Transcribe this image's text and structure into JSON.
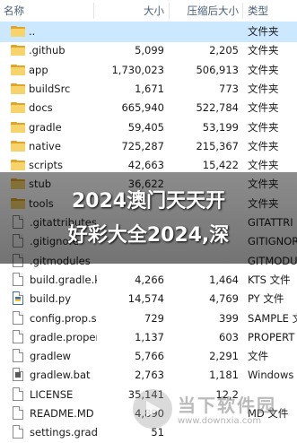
{
  "header": {
    "name": "名称",
    "size": "大小",
    "compressed": "压缩后大小",
    "type": "类型"
  },
  "rows": [
    {
      "name": "..",
      "size": "",
      "compressed": "",
      "type": "文件夹",
      "icon": "parent-folder-icon"
    },
    {
      "name": ".github",
      "size": "5,099",
      "compressed": "2,205",
      "type": "文件夹",
      "icon": "folder-icon"
    },
    {
      "name": "app",
      "size": "1,730,023",
      "compressed": "506,913",
      "type": "文件夹",
      "icon": "folder-icon"
    },
    {
      "name": "buildSrc",
      "size": "1,671",
      "compressed": "773",
      "type": "文件夹",
      "icon": "folder-icon"
    },
    {
      "name": "docs",
      "size": "665,940",
      "compressed": "522,784",
      "type": "文件夹",
      "icon": "folder-icon"
    },
    {
      "name": "gradle",
      "size": "59,405",
      "compressed": "53,199",
      "type": "文件夹",
      "icon": "folder-icon"
    },
    {
      "name": "native",
      "size": "725,287",
      "compressed": "215,367",
      "type": "文件夹",
      "icon": "folder-icon"
    },
    {
      "name": "scripts",
      "size": "42,663",
      "compressed": "15,422",
      "type": "文件夹",
      "icon": "folder-icon"
    },
    {
      "name": "stub",
      "size": "36,622",
      "compressed": "",
      "type": "文件夹",
      "icon": "folder-icon"
    },
    {
      "name": "tools",
      "size": "",
      "compressed": "",
      "type": "文件夹",
      "icon": "folder-icon"
    },
    {
      "name": ".gitattributes",
      "size": "",
      "compressed": "",
      "type": "GITATTRI",
      "icon": "file-icon"
    },
    {
      "name": ".gitignore",
      "size": "",
      "compressed": "",
      "type": "GITIGNOR",
      "icon": "file-icon"
    },
    {
      "name": ".gitmodules",
      "size": "",
      "compressed": "",
      "type": "GITMODU",
      "icon": "file-icon"
    },
    {
      "name": "build.gradle.kts",
      "size": "4,266",
      "compressed": "1,464",
      "type": "KTS 文件",
      "icon": "file-icon"
    },
    {
      "name": "build.py",
      "size": "14,574",
      "compressed": "4,769",
      "type": "PY 文件",
      "icon": "python-file-icon"
    },
    {
      "name": "config.prop.sa...",
      "size": "729",
      "compressed": "399",
      "type": "SAMPLE 文",
      "icon": "file-icon"
    },
    {
      "name": "gradle.propert...",
      "size": "1,137",
      "compressed": "603",
      "type": "PROPERT",
      "icon": "file-icon"
    },
    {
      "name": "gradlew",
      "size": "5,766",
      "compressed": "2,291",
      "type": "文件",
      "icon": "file-icon"
    },
    {
      "name": "gradlew.bat",
      "size": "2,763",
      "compressed": "1,181",
      "type": "Windows",
      "icon": "batch-file-icon"
    },
    {
      "name": "LICENSE",
      "size": "35,141",
      "compressed": "12,2",
      "type": "",
      "icon": "file-icon"
    },
    {
      "name": "README.MD",
      "size": "4,890",
      "compressed": "",
      "type": "MD 文件",
      "icon": "file-icon"
    },
    {
      "name": "settings.gradle...",
      "size": "51",
      "compressed": "",
      "type": "",
      "icon": "file-icon"
    }
  ],
  "overlay": {
    "line1": "2024澳门天天开",
    "line2": "好彩大全2024,深"
  },
  "watermark": {
    "title": "当下软件园",
    "url": "www.downxia.com"
  },
  "colors": {
    "selected_row": "#cce8ff",
    "header_text": "#4c607a"
  }
}
